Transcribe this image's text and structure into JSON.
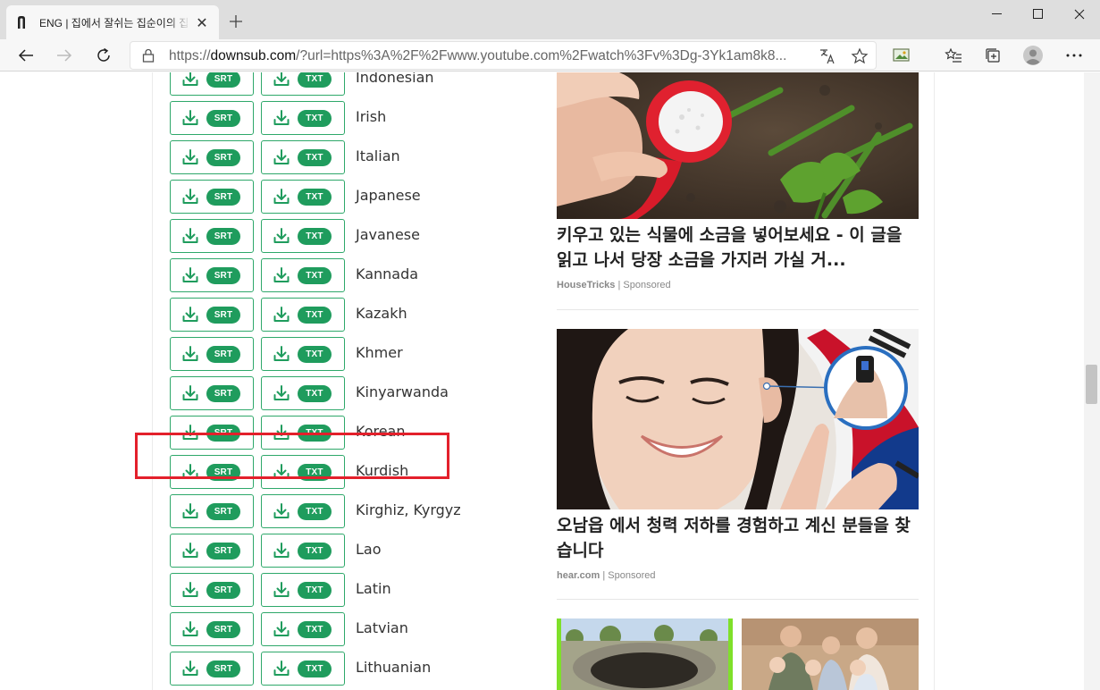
{
  "browser": {
    "tab_title": "ENG | 집에서 잘쉬는 집순이의 집",
    "url_prefix": "https://",
    "url_host": "downsub.com",
    "url_rest": "/?url=https%3A%2F%2Fwww.youtube.com%2Fwatch%3Fv%3Dg-3Yk1am8k8..."
  },
  "subtitles": {
    "srt_label": "SRT",
    "txt_label": "TXT",
    "languages": [
      "Indonesian",
      "Irish",
      "Italian",
      "Japanese",
      "Javanese",
      "Kannada",
      "Kazakh",
      "Khmer",
      "Kinyarwanda",
      "Korean",
      "Kurdish",
      "Kirghiz, Kyrgyz",
      "Lao",
      "Latin",
      "Latvian",
      "Lithuanian"
    ],
    "highlighted": "Korean"
  },
  "ads": [
    {
      "title": "키우고 있는 식물에 소금을 넣어보세요 - 이 글을 읽고 나서 당장 소금을 가지러 가실 거...",
      "source": "HouseTricks",
      "sponsored": "| Sponsored"
    },
    {
      "title": "오남읍 에서 청력 저하를 경험하고 계신 분들을 찾습니다",
      "source": "hear.com",
      "sponsored": "| Sponsored"
    }
  ],
  "colors": {
    "accent": "#1f9c5d",
    "highlight": "#e3202b"
  }
}
